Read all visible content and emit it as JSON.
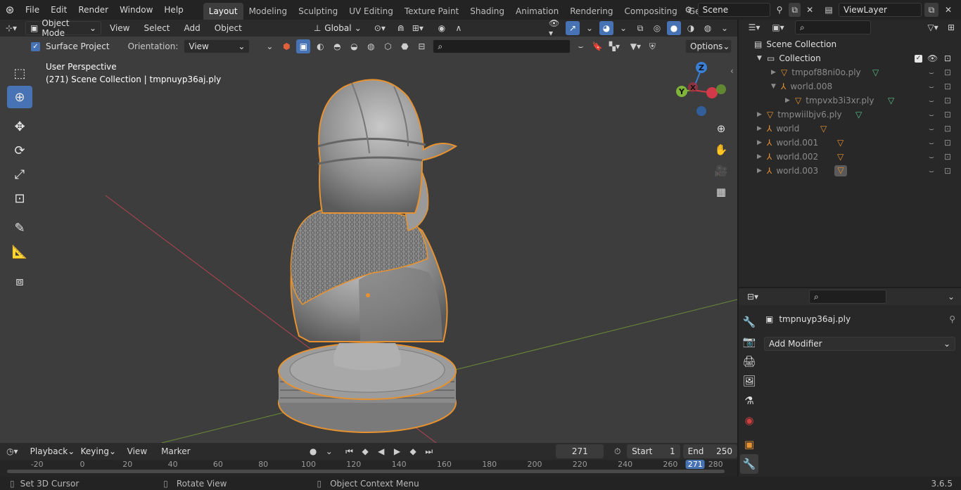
{
  "menubar": {
    "logo": "blender-logo",
    "items": [
      "File",
      "Edit",
      "Render",
      "Window",
      "Help"
    ]
  },
  "workspaces": {
    "tabs": [
      "Layout",
      "Modeling",
      "Sculpting",
      "UV Editing",
      "Texture Paint",
      "Shading",
      "Animation",
      "Rendering",
      "Compositing",
      "Geometry Noc"
    ],
    "active": "Layout"
  },
  "scene": {
    "name": "Scene",
    "view_layer": "ViewLayer"
  },
  "viewport_header": {
    "mode": "Object Mode",
    "menus": [
      "View",
      "Select",
      "Add",
      "Object"
    ],
    "transform_orientation": "Global"
  },
  "tool_settings": {
    "surface_project_label": "Surface Project",
    "orientation_label": "Orientation:",
    "orientation_value": "View",
    "options_label": "Options"
  },
  "overlay_text": {
    "perspective": "User Perspective",
    "object_info": "(271) Scene Collection | tmpnuyp36aj.ply"
  },
  "gizmo": {
    "x": "X",
    "y": "Y",
    "z": "Z"
  },
  "outliner": {
    "root": "Scene Collection",
    "items": [
      {
        "name": "Collection",
        "indent": 0
      },
      {
        "name": "tmpof88ni0o.ply",
        "indent": 1
      },
      {
        "name": "world.008",
        "indent": 1
      },
      {
        "name": "tmpvxb3i3xr.ply",
        "indent": 2
      },
      {
        "name": "tmpwiilbjv6.ply",
        "indent": 0
      },
      {
        "name": "world",
        "indent": 0
      },
      {
        "name": "world.001",
        "indent": 0
      },
      {
        "name": "world.002",
        "indent": 0
      },
      {
        "name": "world.003",
        "indent": 0
      }
    ]
  },
  "properties": {
    "object_name": "tmpnuyp36aj.ply",
    "add_modifier_label": "Add Modifier"
  },
  "timeline": {
    "menus": [
      "Playback",
      "Keying",
      "View",
      "Marker"
    ],
    "current_frame": "271",
    "start_label": "Start",
    "start_value": "1",
    "end_label": "End",
    "end_value": "250",
    "ticks": [
      "-20",
      "0",
      "20",
      "40",
      "60",
      "80",
      "100",
      "120",
      "140",
      "160",
      "180",
      "200",
      "220",
      "240",
      "260",
      "271",
      "280"
    ]
  },
  "statusbar": {
    "hints": [
      "Set 3D Cursor",
      "Rotate View",
      "Object Context Menu"
    ],
    "version": "3.6.5"
  },
  "colors": {
    "accent": "#4772b3",
    "selection_outline": "#e8922f",
    "x_axis": "#d23a4a",
    "y_axis": "#7fb53a",
    "z_axis": "#3a7fd6"
  }
}
